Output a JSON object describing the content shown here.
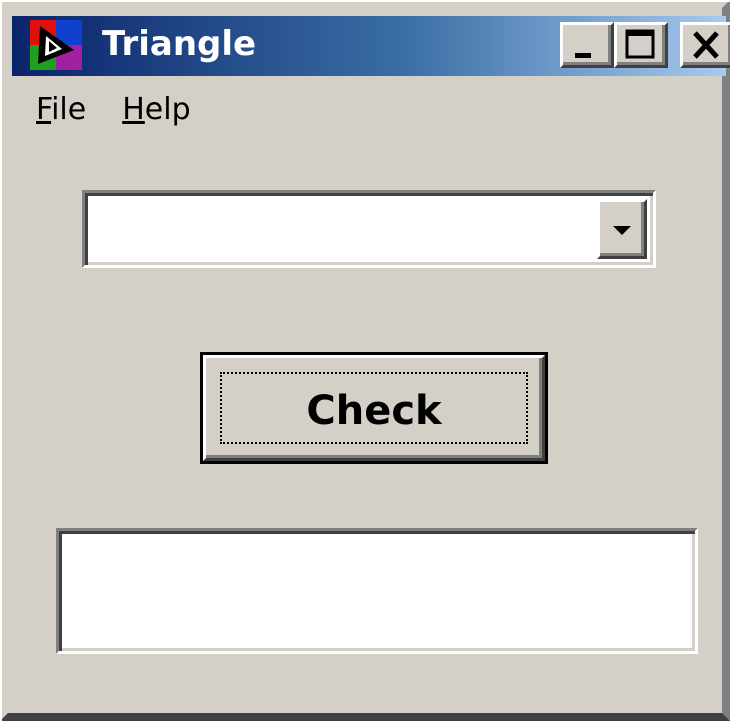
{
  "window": {
    "title": "Triangle",
    "icon": "triangle-app-icon",
    "controls": {
      "minimize_icon": "minimize-icon",
      "maximize_icon": "maximize-icon",
      "close_icon": "close-icon"
    }
  },
  "menu": {
    "items": [
      {
        "label_rest": "ile",
        "mnemonic": "F"
      },
      {
        "label_rest": "elp",
        "mnemonic": "H"
      }
    ]
  },
  "combo": {
    "value": "",
    "arrow_icon": "dropdown-arrow-icon"
  },
  "check_button": {
    "label": "Check"
  },
  "output": {
    "value": ""
  },
  "colors": {
    "face": "#d4d0c8",
    "title_start": "#0a246a",
    "title_end": "#a6caf0",
    "field_bg": "#ffffff"
  }
}
